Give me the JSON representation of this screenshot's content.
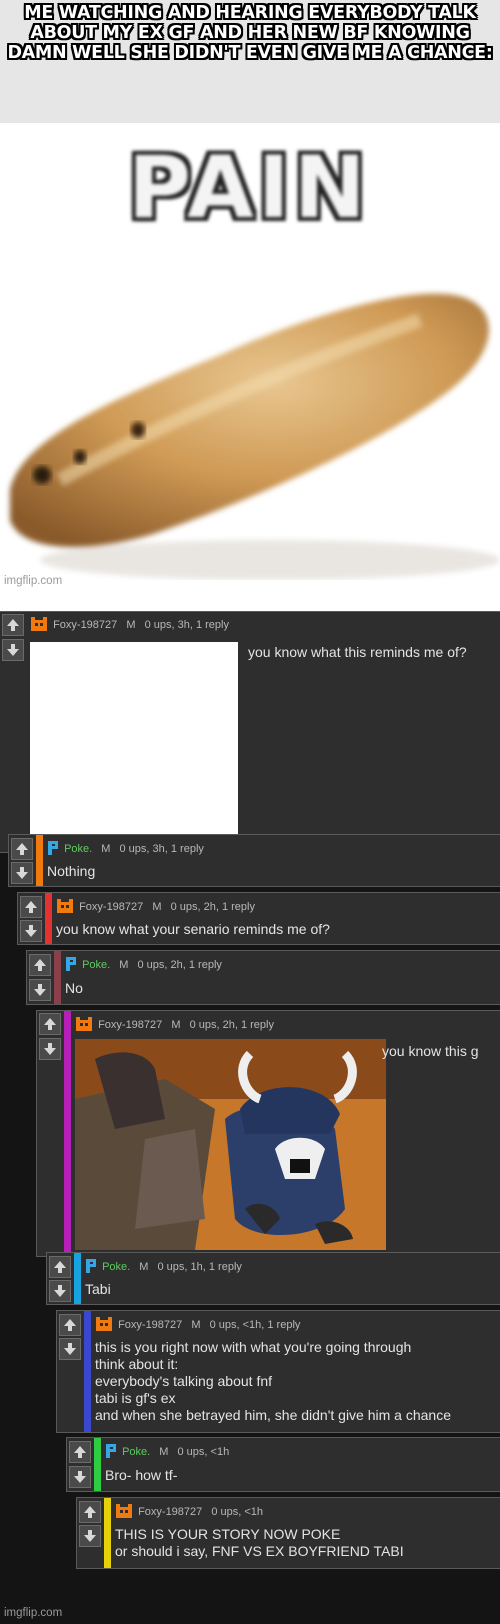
{
  "meme": {
    "caption": "ME WATCHING AND HEARING EVERYBODY TALK ABOUT MY EX GF AND HER NEW BF KNOWING DAMN WELL SHE DIDN'T EVEN GIVE ME A CHANCE:",
    "pain_text": "PAIN",
    "watermark": "imgflip.com"
  },
  "colors": {
    "background": "#141414",
    "card": "#2e2e2e",
    "poke_name": "#5ecb5e",
    "foxy_icon": "#f07a10",
    "poke_icon": "#35a7e6",
    "vote_button": "#4a4a4a"
  },
  "comments": [
    {
      "user": "Foxy-198727",
      "icon": "foxy-icon",
      "mark": "M",
      "stats": "0 ups, 3h, 1 reply",
      "text": "you know what this reminds me of?",
      "bar_color": "#2e2e2e"
    },
    {
      "user": "Poke.",
      "icon": "poke-icon",
      "mark": "M",
      "stats": "0 ups, 3h, 1 reply",
      "text": "Nothing",
      "bar_color": "#f07a10"
    },
    {
      "user": "Foxy-198727",
      "icon": "foxy-icon",
      "mark": "M",
      "stats": "0 ups, 2h, 1 reply",
      "text": "you know what your senario reminds me of?",
      "bar_color": "#e23232"
    },
    {
      "user": "Poke.",
      "icon": "poke-icon",
      "mark": "M",
      "stats": "0 ups, 2h, 1 reply",
      "text": "No",
      "bar_color": "#8a3f4a"
    },
    {
      "user": "Foxy-198727",
      "icon": "foxy-icon",
      "mark": "M",
      "stats": "0 ups, 2h, 1 reply",
      "text": "you know this g",
      "bar_color": "#b81fb8"
    },
    {
      "user": "Poke.",
      "icon": "poke-icon",
      "mark": "M",
      "stats": "0 ups, 1h, 1 reply",
      "text": "Tabi",
      "bar_color": "#17a3e0"
    },
    {
      "user": "Foxy-198727",
      "icon": "foxy-icon",
      "mark": "M",
      "stats": "0 ups, <1h, 1 reply",
      "lines": [
        "this is you right now with what you're going through",
        "think about it:",
        "everybody's talking about fnf",
        "tabi is gf's ex",
        "and when she betrayed him, she didn't give him a chance"
      ],
      "bar_color": "#3a48d0"
    },
    {
      "user": "Poke.",
      "icon": "poke-icon",
      "mark": "M",
      "stats": "0 ups, <1h",
      "text": "Bro- how tf-",
      "bar_color": "#2ecc40"
    },
    {
      "user": "Foxy-198727",
      "icon": "foxy-icon",
      "mark": "",
      "stats": "0 ups, <1h",
      "lines": [
        "THIS IS YOUR STORY NOW POKE",
        "or should i say, FNF VS EX BOYFRIEND TABI"
      ],
      "bar_color": "#e6d20a"
    }
  ]
}
